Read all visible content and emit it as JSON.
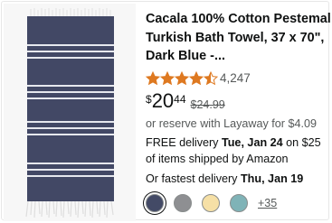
{
  "product": {
    "title_lines": [
      "Cacala 100% Cotton Pestemal",
      "Turkish Bath Towel, 37 x 70\",",
      "Dark Blue -..."
    ],
    "rating": 4.5,
    "rating_count": "4,247",
    "price": {
      "symbol": "$",
      "whole": "20",
      "fraction": "44",
      "list_price": "$24.99"
    },
    "layaway": "or reserve with Layaway for $4.09",
    "delivery": {
      "prefix": "FREE delivery ",
      "date": "Tue, Jan 24",
      "suffix": " on $25 of items shipped by Amazon"
    },
    "fastest": {
      "prefix": "Or fastest delivery ",
      "date": "Thu, Jan 19"
    },
    "swatches": [
      {
        "color": "#434a66",
        "selected": true
      },
      {
        "color": "#8e8f92",
        "selected": false
      },
      {
        "color": "#f6e0a6",
        "selected": false
      },
      {
        "color": "#7fb3b7",
        "selected": false
      }
    ],
    "more_colors": "+35"
  },
  "colors": {
    "star": "#de7921",
    "towel": "#424865",
    "stripe": "#e6e8ee"
  }
}
